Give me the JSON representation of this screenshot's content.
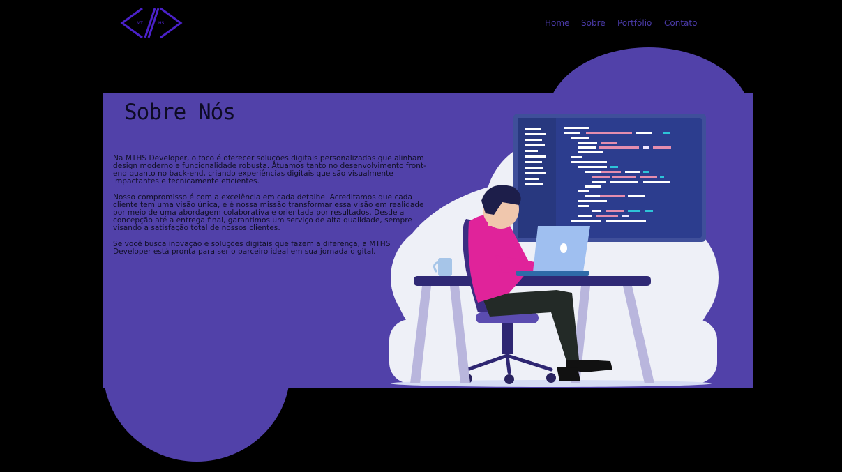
{
  "logo": {
    "icon": "code-brackets-logo",
    "left_text": "MT",
    "right_text": "HS",
    "color": "#4b21c9"
  },
  "nav": {
    "items": [
      {
        "label": "Home"
      },
      {
        "label": "Sobre"
      },
      {
        "label": "Portfólio"
      },
      {
        "label": "Contato"
      }
    ],
    "color": "#4a3aa8"
  },
  "about": {
    "title": "Sobre Nós",
    "paragraphs": [
      "Na MTHS Developer, o foco é oferecer soluções digitais personalizadas que alinham design moderno e funcionalidade robusta. Atuamos tanto no desenvolvimento front-end quanto no back-end, criando experiências digitais que são visualmente impactantes e tecnicamente eficientes.",
      "Nosso compromisso é com a excelência em cada detalhe. Acreditamos que cada cliente tem uma visão única, e é nossa missão transformar essa visão em realidade por meio de uma abordagem colaborativa e orientada por resultados. Desde a concepção até a entrega final, garantimos um serviço de alta qualidade, sempre visando a satisfação total de nossos clientes.",
      "Se você busca inovação e soluções digitais que fazem a diferença, a MTHS Developer está pronta para ser o parceiro ideal em sua jornada digital."
    ]
  },
  "colors": {
    "background": "#000000",
    "panel": "#5141a9",
    "text": "#111026"
  },
  "illustration": {
    "icon": "developer-at-desk-illustration"
  }
}
